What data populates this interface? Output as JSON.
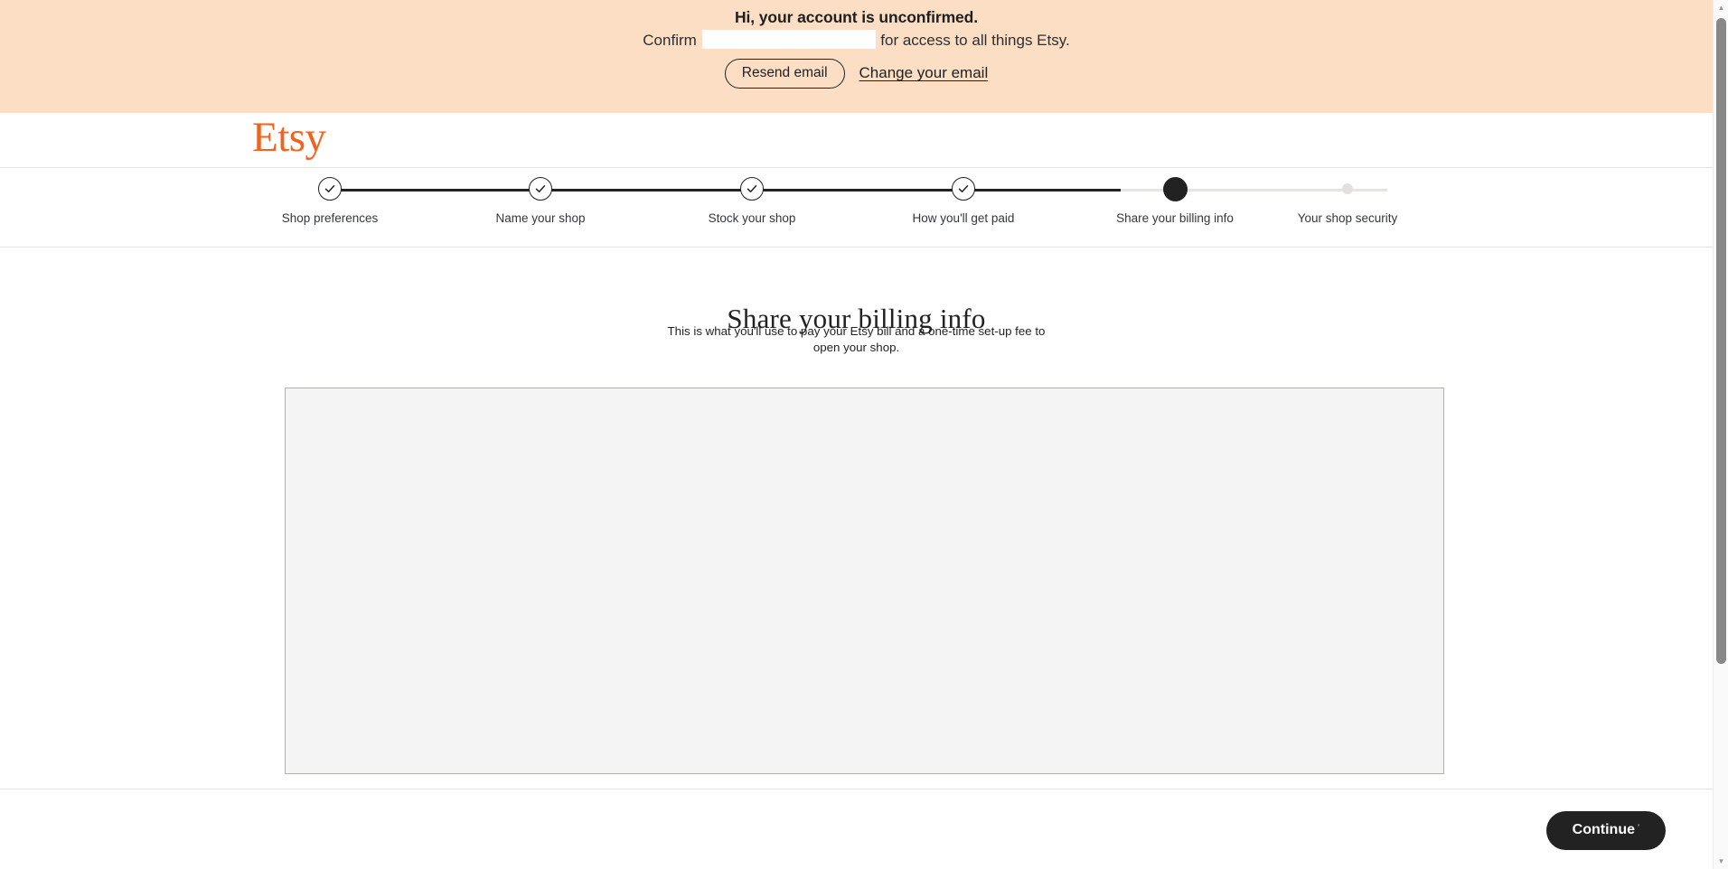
{
  "banner": {
    "title": "Hi, your account is unconfirmed.",
    "line_prefix": "Confirm",
    "email_value": "",
    "line_suffix": "for access to all things Etsy.",
    "resend_label": "Resend email",
    "change_email_label": "Change your email",
    "background_color": "#fbdec4"
  },
  "header": {
    "logo_text": "Etsy",
    "logo_color": "#f1641e"
  },
  "stepper": {
    "current_index": 4,
    "steps": [
      {
        "label": "Shop preferences",
        "state": "complete"
      },
      {
        "label": "Name your shop",
        "state": "complete"
      },
      {
        "label": "Stock your shop",
        "state": "complete"
      },
      {
        "label": "How you'll get paid",
        "state": "complete"
      },
      {
        "label": "Share your billing info",
        "state": "current"
      },
      {
        "label": "Your shop security",
        "state": "upcoming"
      }
    ]
  },
  "main": {
    "heading": "Share your billing info",
    "subheading": "This is what you'll use to pay your Etsy bill and a one-time set-up fee to open your shop.",
    "billing_panel_placeholder": ""
  },
  "footer": {
    "continue_label": "Continue",
    "continue_caret": "’",
    "continue_color": "#222222"
  },
  "scrollbar": {
    "up_arrow": "▲",
    "down_arrow": "▼"
  }
}
